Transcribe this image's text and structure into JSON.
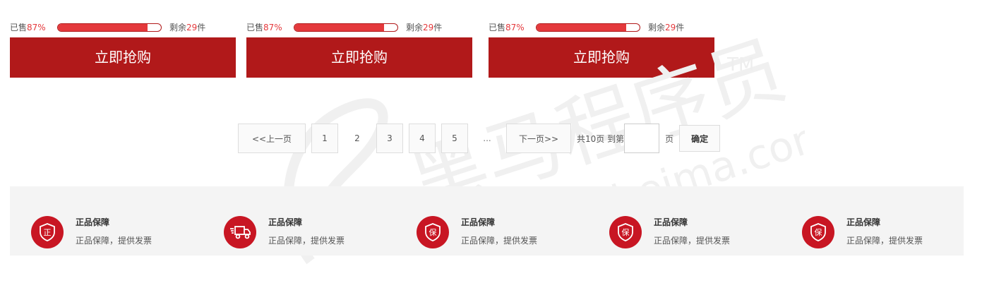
{
  "cards": [
    {
      "sold_label": "已售",
      "sold_percent": "87%",
      "sold_fraction": 0.87,
      "remain_label": "剩余",
      "remain_count": "29",
      "remain_unit": "件",
      "buy_label": "立即抢购"
    },
    {
      "sold_label": "已售",
      "sold_percent": "87%",
      "sold_fraction": 0.87,
      "remain_label": "剩余",
      "remain_count": "29",
      "remain_unit": "件",
      "buy_label": "立即抢购"
    },
    {
      "sold_label": "已售",
      "sold_percent": "87%",
      "sold_fraction": 0.87,
      "remain_label": "剩余",
      "remain_count": "29",
      "remain_unit": "件",
      "buy_label": "立即抢购"
    }
  ],
  "pagination": {
    "prev": "<<上一页",
    "pages": [
      "1",
      "2",
      "3",
      "4",
      "5"
    ],
    "current": "2",
    "ellipsis": "...",
    "next": "下一页>>",
    "total": "共10页 到第",
    "jump_value": "",
    "page_unit": "页",
    "confirm": "确定"
  },
  "guarantees": [
    {
      "icon": "shield-zheng-icon",
      "glyph": "正",
      "title": "正品保障",
      "desc": "正品保障，提供发票"
    },
    {
      "icon": "delivery-truck-icon",
      "glyph": "",
      "title": "正品保障",
      "desc": "正品保障，提供发票"
    },
    {
      "icon": "shield-bao-icon",
      "glyph": "保",
      "title": "正品保障",
      "desc": "正品保障，提供发票"
    },
    {
      "icon": "shield-bao-icon",
      "glyph": "保",
      "title": "正品保障",
      "desc": "正品保障，提供发票"
    },
    {
      "icon": "shield-bao-icon",
      "glyph": "保",
      "title": "正品保障",
      "desc": "正品保障，提供发票"
    }
  ],
  "watermark": {
    "brand": "黑马程序员",
    "url": "www.itheima.com",
    "tm": "TM"
  },
  "colors": {
    "accent": "#b1191a",
    "progress": "#e4393c",
    "icon_bg": "#c81623"
  }
}
